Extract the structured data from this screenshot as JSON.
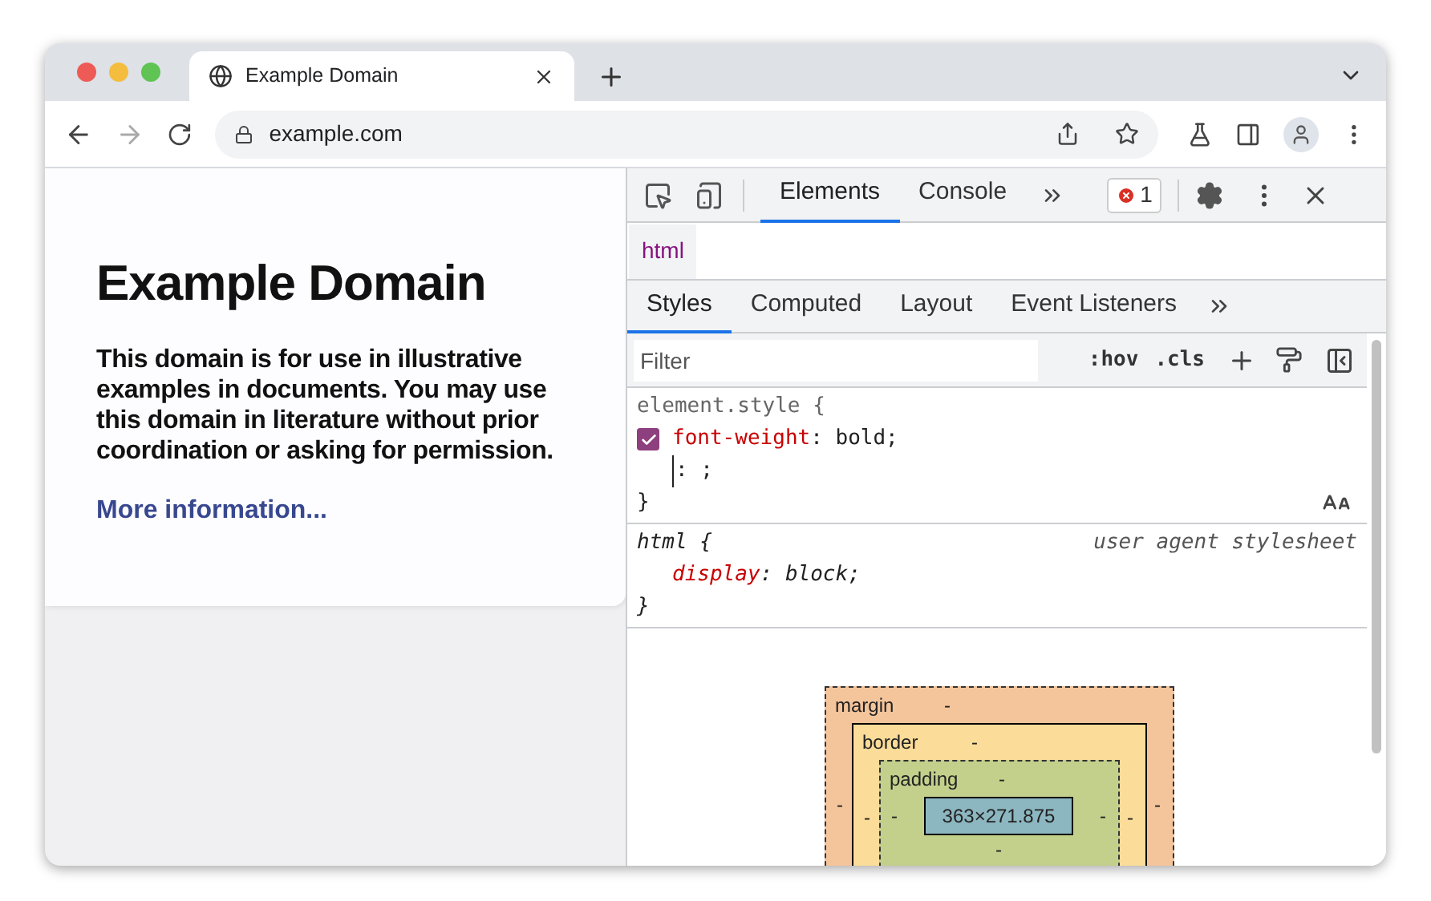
{
  "browser": {
    "tab": {
      "title": "Example Domain"
    },
    "address": "example.com"
  },
  "page": {
    "heading": "Example Domain",
    "paragraph": "This domain is for use in illustrative examples in documents. You may use this domain in literature without prior coordination or asking for permission.",
    "link": "More information..."
  },
  "devtools": {
    "tabs": [
      {
        "label": "Elements",
        "selected": true
      },
      {
        "label": "Console",
        "selected": false
      }
    ],
    "error_count": "1",
    "breadcrumb": "html",
    "sidebar_tabs": [
      {
        "label": "Styles",
        "selected": true
      },
      {
        "label": "Computed",
        "selected": false
      },
      {
        "label": "Layout",
        "selected": false
      },
      {
        "label": "Event Listeners",
        "selected": false
      }
    ],
    "filter": {
      "placeholder": "Filter"
    },
    "filter_buttons": [
      ":hov",
      ".cls"
    ],
    "rules": [
      {
        "selector": "element.style {",
        "declarations": [
          {
            "property": "font-weight",
            "rest": ": bold;",
            "checked": true
          }
        ],
        "editing": ": ;",
        "close": "}"
      },
      {
        "selector": "html {",
        "source": "user agent stylesheet",
        "declarations": [
          {
            "property": "display",
            "rest": ": block;"
          }
        ],
        "close": "}"
      }
    ],
    "box_model": {
      "layers": [
        {
          "label": "margin",
          "top": "-",
          "left": "-",
          "right": "-"
        },
        {
          "label": "border",
          "top": "-",
          "left": "-",
          "right": "-"
        },
        {
          "label": "padding",
          "top": "-",
          "left": "-",
          "right": "-",
          "bottom": "-"
        }
      ],
      "content": "363×271.875"
    }
  }
}
